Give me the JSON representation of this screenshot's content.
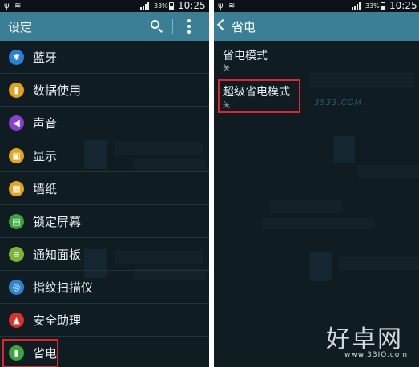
{
  "status_bar": {
    "battery": "33%",
    "time": "10:25"
  },
  "settings": {
    "title": "设定",
    "items": [
      {
        "label": "蓝牙",
        "icon": "bluetooth-icon",
        "color": "#2b7fd6",
        "glyph": "✱"
      },
      {
        "label": "数据使用",
        "icon": "data-usage-icon",
        "color": "#e0a21c",
        "glyph": "▮"
      },
      {
        "label": "声音",
        "icon": "sound-icon",
        "color": "#8a3fd1",
        "glyph": "◀"
      },
      {
        "label": "显示",
        "icon": "display-icon",
        "color": "#e3a51a",
        "glyph": "▣"
      },
      {
        "label": "墙纸",
        "icon": "wallpaper-icon",
        "color": "#e3a51a",
        "glyph": "▦"
      },
      {
        "label": "锁定屏幕",
        "icon": "lock-screen-icon",
        "color": "#3aa53a",
        "glyph": "▤"
      },
      {
        "label": "通知面板",
        "icon": "notification-panel-icon",
        "color": "#7cb534",
        "glyph": "≡"
      },
      {
        "label": "指纹扫描仪",
        "icon": "fingerprint-icon",
        "color": "#2a86cf",
        "glyph": "◎"
      },
      {
        "label": "安全助理",
        "icon": "safety-assistance-icon",
        "color": "#d9302b",
        "glyph": "▲"
      },
      {
        "label": "省电",
        "icon": "battery-icon",
        "color": "#3aa53a",
        "glyph": "▮"
      }
    ]
  },
  "power_saving": {
    "title": "省电",
    "entries": [
      {
        "title": "省电模式",
        "status": "关"
      },
      {
        "title": "超级省电模式",
        "status": "关"
      }
    ]
  },
  "watermark": {
    "site_logo": "好卓网",
    "site_url": "www.33IO.com",
    "overlay_text": "3533.COM"
  },
  "colors": {
    "appbar": "#3a7f96",
    "background": "#0f1c22",
    "highlight": "#e0262c"
  }
}
